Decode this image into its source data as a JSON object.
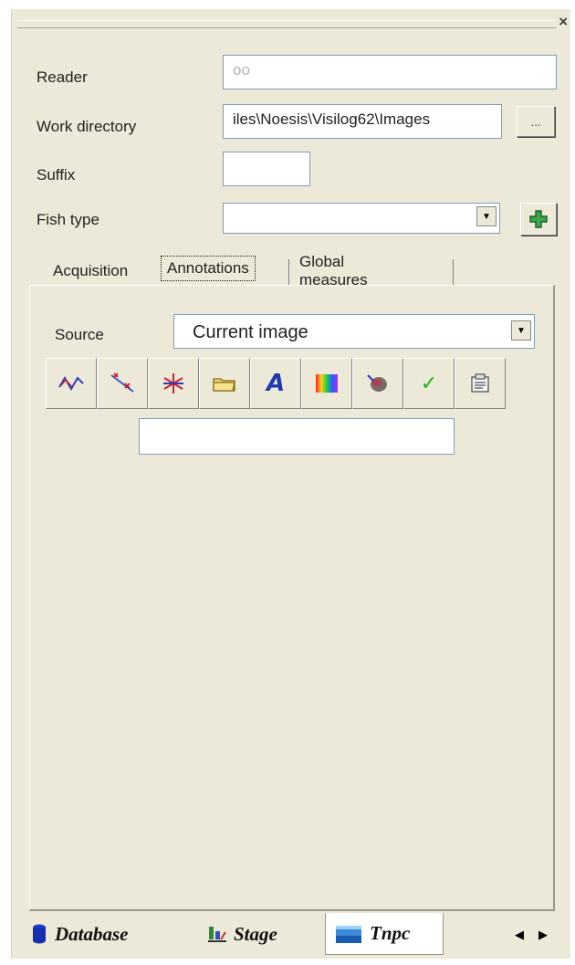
{
  "form": {
    "reader_label": "Reader",
    "reader_value": "oo",
    "workdir_label": "Work directory",
    "workdir_value": "iles\\Noesis\\Visilog62\\Images",
    "browse_label": "...",
    "suffix_label": "Suffix",
    "suffix_value": "",
    "fishtype_label": "Fish type",
    "fishtype_value": ""
  },
  "tabs": [
    {
      "label": "Acquisition"
    },
    {
      "label": "Annotations"
    },
    {
      "label": "Global measures"
    }
  ],
  "annotations": {
    "source_label": "Source",
    "source_value": "Current image",
    "name_field_value": ""
  },
  "tools": [
    {
      "icon": "polyline-icon"
    },
    {
      "icon": "cross-points-icon"
    },
    {
      "icon": "star-point-icon"
    },
    {
      "icon": "folder-icon"
    },
    {
      "icon": "text-icon",
      "glyph": "A"
    },
    {
      "icon": "color-palette-icon"
    },
    {
      "icon": "region-brush-icon"
    },
    {
      "icon": "checkmark-icon",
      "glyph": "✓"
    },
    {
      "icon": "properties-icon"
    }
  ],
  "bottom_tabs": [
    {
      "label": "Database",
      "icon": "database-icon"
    },
    {
      "label": "Stage",
      "icon": "stage-icon"
    },
    {
      "label": "Tnpc",
      "icon": "image-icon"
    }
  ],
  "colors": {
    "panel": "#ece9d8",
    "field_border": "#7f9db9"
  }
}
